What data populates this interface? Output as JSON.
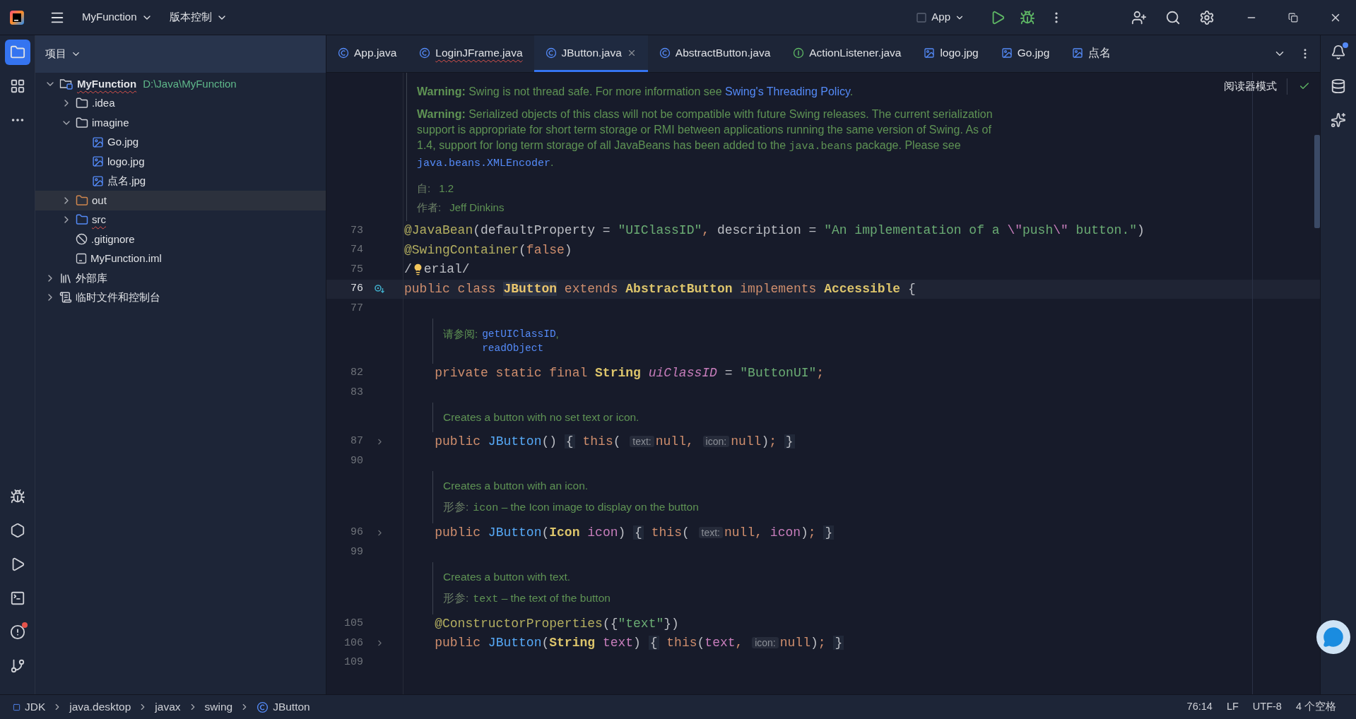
{
  "title_bar": {
    "project": "MyFunction",
    "vcs": "版本控制",
    "run_config": "App"
  },
  "left_tools": [
    {
      "kind": "project",
      "selected": true
    },
    {
      "kind": "structure",
      "selected": false
    },
    {
      "kind": "more",
      "selected": false
    }
  ],
  "left_tools_bottom": [
    {
      "kind": "debug",
      "alert": false
    },
    {
      "kind": "services",
      "alert": false
    },
    {
      "kind": "run",
      "alert": false
    },
    {
      "kind": "terminal",
      "alert": false
    },
    {
      "kind": "problems",
      "alert": true
    },
    {
      "kind": "git",
      "alert": false
    }
  ],
  "right_tools": [
    {
      "kind": "notifications",
      "alert": true
    },
    {
      "kind": "database",
      "alert": false
    },
    {
      "kind": "ai",
      "alert": false
    }
  ],
  "project_panel": {
    "title": "项目",
    "tree": [
      {
        "name": "MyFunction",
        "kind": "module",
        "path": "D:\\Java\\MyFunction",
        "expanded": true,
        "selected": false,
        "error": true,
        "children": [
          {
            "name": ".idea",
            "kind": "folder",
            "expanded": false,
            "selected": false,
            "error": false
          },
          {
            "name": "imagine",
            "kind": "folder",
            "expanded": true,
            "selected": false,
            "error": false,
            "children": [
              {
                "name": "Go.jpg",
                "kind": "image",
                "selected": false,
                "error": false
              },
              {
                "name": "logo.jpg",
                "kind": "image",
                "selected": false,
                "error": false
              },
              {
                "name": "点名.jpg",
                "kind": "image",
                "selected": false,
                "error": false
              }
            ]
          },
          {
            "name": "out",
            "kind": "excluded",
            "expanded": false,
            "selected": true,
            "error": false
          },
          {
            "name": "src",
            "kind": "source",
            "expanded": false,
            "selected": false,
            "error": true
          },
          {
            "name": ".gitignore",
            "kind": "ignore",
            "selected": false,
            "error": false
          },
          {
            "name": "MyFunction.iml",
            "kind": "iml",
            "selected": false,
            "error": false
          }
        ]
      },
      {
        "name": "外部库",
        "kind": "library",
        "expanded": false,
        "selected": false,
        "error": false
      },
      {
        "name": "临时文件和控制台",
        "kind": "scratch",
        "expanded": false,
        "selected": false,
        "error": false
      }
    ]
  },
  "tabs": [
    {
      "label": "App.java",
      "kind": "class",
      "selected": false,
      "error": false
    },
    {
      "label": "LoginJFrame.java",
      "kind": "class",
      "selected": false,
      "error": true
    },
    {
      "label": "JButton.java",
      "kind": "class",
      "selected": true,
      "error": false
    },
    {
      "label": "AbstractButton.java",
      "kind": "class",
      "selected": false,
      "error": false
    },
    {
      "label": "ActionListener.java",
      "kind": "interface",
      "selected": false,
      "error": false
    },
    {
      "label": "logo.jpg",
      "kind": "image",
      "selected": false,
      "error": false
    },
    {
      "label": "Go.jpg",
      "kind": "image",
      "selected": false,
      "error": false
    },
    {
      "label": "点名",
      "kind": "image",
      "selected": false,
      "error": false
    }
  ],
  "editor": {
    "reader_mode": "阅读器模式",
    "blocks": [
      {
        "kind": "doc",
        "nested": false,
        "items": [
          {
            "kind": "para",
            "segments": [
              {
                "kind": "text",
                "text": "**Warning:** Swing is not thread safe. For more information see "
              },
              {
                "kind": "link",
                "text": "Swing's Threading Policy"
              },
              {
                "kind": "text",
                "text": "."
              }
            ]
          },
          {
            "kind": "para",
            "segments": [
              {
                "kind": "text",
                "text": "**Warning:** Serialized objects of this class will not be compatible with future Swing releases. The current serialization support is appropriate for short term storage or RMI between applications running the same version of Swing. As of 1.4, support for long term storage of all JavaBeans has been added to the "
              },
              {
                "kind": "code",
                "text": "java.beans"
              },
              {
                "kind": "text",
                "text": " package. Please see "
              },
              {
                "kind": "codelink",
                "text": "java.beans.XMLEncoder"
              },
              {
                "kind": "text",
                "text": "."
              }
            ]
          },
          {
            "kind": "tag",
            "label": "自:",
            "value": "1.2"
          },
          {
            "kind": "tag",
            "label": "作者:",
            "value": "Jeff Dinkins"
          }
        ]
      },
      {
        "kind": "code",
        "line": "73",
        "current": false,
        "tokens": [
          {
            "kind": "annotation",
            "text": "@JavaBean"
          },
          {
            "kind": "plain",
            "text": "(defaultProperty = "
          },
          {
            "kind": "string",
            "text": "\"UIClassID\""
          },
          {
            "kind": "keyword",
            "text": ", "
          },
          {
            "kind": "plain",
            "text": "description = "
          },
          {
            "kind": "string",
            "text": "\"An implementation of a "
          },
          {
            "kind": "escape",
            "text": "\\\""
          },
          {
            "kind": "string",
            "text": "push"
          },
          {
            "kind": "escape",
            "text": "\\\""
          },
          {
            "kind": "string",
            "text": " button.\""
          },
          {
            "kind": "plain",
            "text": ")"
          }
        ]
      },
      {
        "kind": "code",
        "line": "74",
        "current": false,
        "tokens": [
          {
            "kind": "annotation",
            "text": "@SwingContainer"
          },
          {
            "kind": "plain",
            "text": "("
          },
          {
            "kind": "keyword",
            "text": "false"
          },
          {
            "kind": "plain",
            "text": ")"
          }
        ]
      },
      {
        "kind": "code",
        "line": "75",
        "current": false,
        "tokens": [
          {
            "kind": "plain",
            "text": "/"
          },
          {
            "kind": "bulb"
          },
          {
            "kind": "plain",
            "text": "erial/"
          }
        ]
      },
      {
        "kind": "code",
        "line": "76",
        "current": true,
        "implements_marker": true,
        "tokens": [
          {
            "kind": "keyword",
            "text": "public class "
          },
          {
            "kind": "decl",
            "text": "JButton"
          },
          {
            "kind": "keyword",
            "text": " extends "
          },
          {
            "kind": "type",
            "text": "AbstractButton"
          },
          {
            "kind": "keyword",
            "text": " implements "
          },
          {
            "kind": "type",
            "text": "Accessible"
          },
          {
            "kind": "plain",
            "text": " {"
          }
        ]
      },
      {
        "kind": "code",
        "line": "77",
        "current": false
      },
      {
        "kind": "doc",
        "nested": true,
        "items": [
          {
            "kind": "see",
            "label": "请参阅:",
            "links": [
              "getUIClassID",
              "readObject"
            ],
            "separator": ","
          }
        ]
      },
      {
        "kind": "code",
        "line": "82",
        "current": false,
        "tokens": [
          {
            "kind": "keyword",
            "text": "    private static final "
          },
          {
            "kind": "type",
            "text": "String"
          },
          {
            "kind": "field",
            "text": " uiClassID"
          },
          {
            "kind": "plain",
            "text": " = "
          },
          {
            "kind": "string",
            "text": "\"ButtonUI\""
          },
          {
            "kind": "keyword",
            "text": ";"
          }
        ]
      },
      {
        "kind": "code",
        "line": "83",
        "current": false
      },
      {
        "kind": "doc",
        "nested": true,
        "items": [
          {
            "kind": "line",
            "text": "Creates a button with no set text or icon."
          }
        ]
      },
      {
        "kind": "code",
        "line": "87",
        "current": false,
        "fold": true,
        "tokens": [
          {
            "kind": "keyword",
            "text": "    public "
          },
          {
            "kind": "method",
            "text": "JButton"
          },
          {
            "kind": "plain",
            "text": "() "
          },
          {
            "kind": "brace",
            "text": "{"
          },
          {
            "kind": "keyword",
            "text": " this"
          },
          {
            "kind": "plain",
            "text": "( "
          },
          {
            "kind": "hint",
            "text": "text:"
          },
          {
            "kind": "keyword",
            "text": "null, "
          },
          {
            "kind": "hint",
            "text": "icon:"
          },
          {
            "kind": "keyword",
            "text": "null"
          },
          {
            "kind": "plain",
            "text": ")"
          },
          {
            "kind": "keyword",
            "text": "; "
          },
          {
            "kind": "brace",
            "text": "}"
          }
        ]
      },
      {
        "kind": "code",
        "line": "90",
        "current": false
      },
      {
        "kind": "doc",
        "nested": true,
        "items": [
          {
            "kind": "line",
            "text": "Creates a button with an icon."
          },
          {
            "kind": "param",
            "label": "形参:",
            "name": "icon",
            "text": "– the Icon image to display on the button"
          }
        ]
      },
      {
        "kind": "code",
        "line": "96",
        "current": false,
        "fold": true,
        "tokens": [
          {
            "kind": "keyword",
            "text": "    public "
          },
          {
            "kind": "method",
            "text": "JButton"
          },
          {
            "kind": "plain",
            "text": "("
          },
          {
            "kind": "type",
            "text": "Icon"
          },
          {
            "kind": "param",
            "text": " icon"
          },
          {
            "kind": "plain",
            "text": ") "
          },
          {
            "kind": "brace",
            "text": "{"
          },
          {
            "kind": "keyword",
            "text": " this"
          },
          {
            "kind": "plain",
            "text": "( "
          },
          {
            "kind": "hint",
            "text": "text:"
          },
          {
            "kind": "keyword",
            "text": "null, "
          },
          {
            "kind": "param",
            "text": "icon"
          },
          {
            "kind": "plain",
            "text": ")"
          },
          {
            "kind": "keyword",
            "text": "; "
          },
          {
            "kind": "brace",
            "text": "}"
          }
        ]
      },
      {
        "kind": "code",
        "line": "99",
        "current": false
      },
      {
        "kind": "doc",
        "nested": true,
        "items": [
          {
            "kind": "line",
            "text": "Creates a button with text."
          },
          {
            "kind": "param",
            "label": "形参:",
            "name": "text",
            "text": "– the text of the button"
          }
        ]
      },
      {
        "kind": "code",
        "line": "105",
        "current": false,
        "tokens": [
          {
            "kind": "annotation",
            "text": "    @ConstructorProperties"
          },
          {
            "kind": "plain",
            "text": "({"
          },
          {
            "kind": "string",
            "text": "\"text\""
          },
          {
            "kind": "plain",
            "text": "})"
          }
        ]
      },
      {
        "kind": "code",
        "line": "106",
        "current": false,
        "fold": true,
        "tokens": [
          {
            "kind": "keyword",
            "text": "    public "
          },
          {
            "kind": "method",
            "text": "JButton"
          },
          {
            "kind": "plain",
            "text": "("
          },
          {
            "kind": "type",
            "text": "String"
          },
          {
            "kind": "param",
            "text": " text"
          },
          {
            "kind": "plain",
            "text": ") "
          },
          {
            "kind": "brace",
            "text": "{"
          },
          {
            "kind": "keyword",
            "text": " this"
          },
          {
            "kind": "plain",
            "text": "("
          },
          {
            "kind": "param",
            "text": "text"
          },
          {
            "kind": "keyword",
            "text": ", "
          },
          {
            "kind": "hint",
            "text": "icon:"
          },
          {
            "kind": "keyword",
            "text": "null"
          },
          {
            "kind": "plain",
            "text": ")"
          },
          {
            "kind": "keyword",
            "text": "; "
          },
          {
            "kind": "brace",
            "text": "}"
          }
        ]
      },
      {
        "kind": "code",
        "line": "109",
        "current": false
      }
    ]
  },
  "breadcrumbs": [
    {
      "label": "JDK",
      "kind": "jdk"
    },
    {
      "label": "java.desktop",
      "kind": "package"
    },
    {
      "label": "javax",
      "kind": "package"
    },
    {
      "label": "swing",
      "kind": "package"
    },
    {
      "label": "JButton",
      "kind": "class"
    }
  ],
  "status": [
    "76:14",
    "LF",
    "UTF-8",
    "4 个空格"
  ]
}
